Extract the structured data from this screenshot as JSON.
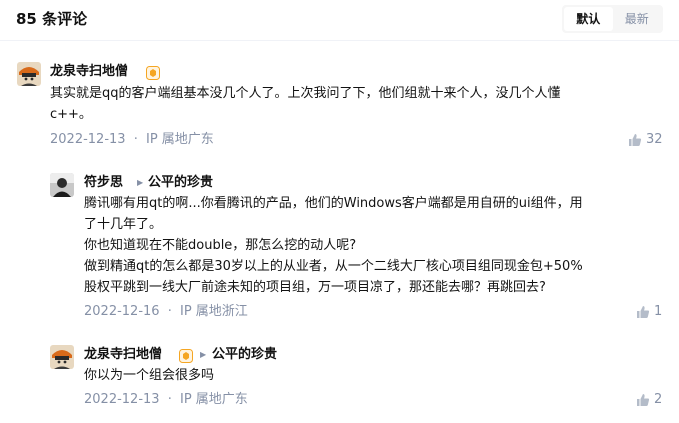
{
  "header": {
    "count_label": "85 条评论",
    "sort_default": "默认",
    "sort_latest": "最新"
  },
  "comments": [
    {
      "author": "龙泉寺扫地僧",
      "lines": [
        "其实就是qq的客户端组基本没几个人了。上次我问了下，他们组就十来个人，没几个人懂",
        "c++。"
      ],
      "date": "2022-12-13",
      "location": "IP 属地广东",
      "likes": "32"
    },
    {
      "author": "符步思",
      "reply_to": "公平的珍贵",
      "lines": [
        "腾讯哪有用qt的啊...你看腾讯的产品，他们的Windows客户端都是用自研的ui组件，用",
        "了十几年了。",
        "你也知道现在不能double，那怎么挖的动人呢?",
        "做到精通qt的怎么都是30岁以上的从业者，从一个二线大厂核心项目组同现金包+50%",
        "股权平跳到一线大厂前途未知的项目组，万一项目凉了，那还能去哪？再跳回去?"
      ],
      "date": "2022-12-16",
      "location": "IP 属地浙江",
      "likes": "1"
    },
    {
      "author": "龙泉寺扫地僧",
      "reply_to": "公平的珍贵",
      "lines": [
        "你以为一个组会很多吗"
      ],
      "date": "2022-12-13",
      "location": "IP 属地广东",
      "likes": "2"
    }
  ],
  "meta_separator": "·",
  "colors": {
    "text": "#121212",
    "muted": "#8590a6",
    "badge": "#f5a623"
  }
}
